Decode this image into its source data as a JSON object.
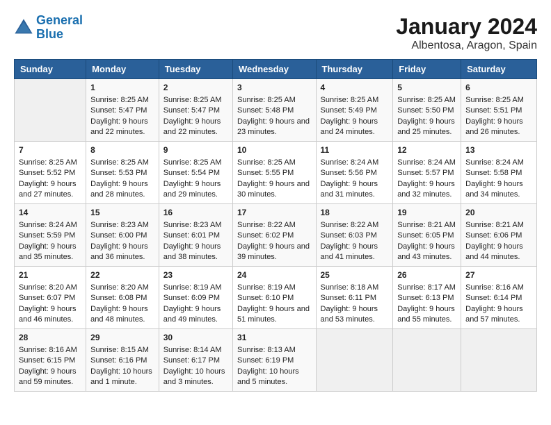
{
  "header": {
    "logo_line1": "General",
    "logo_line2": "Blue",
    "month": "January 2024",
    "location": "Albentosa, Aragon, Spain"
  },
  "days_of_week": [
    "Sunday",
    "Monday",
    "Tuesday",
    "Wednesday",
    "Thursday",
    "Friday",
    "Saturday"
  ],
  "weeks": [
    [
      {
        "day": "",
        "sunrise": "",
        "sunset": "",
        "daylight": ""
      },
      {
        "day": "1",
        "sunrise": "Sunrise: 8:25 AM",
        "sunset": "Sunset: 5:47 PM",
        "daylight": "Daylight: 9 hours and 22 minutes."
      },
      {
        "day": "2",
        "sunrise": "Sunrise: 8:25 AM",
        "sunset": "Sunset: 5:47 PM",
        "daylight": "Daylight: 9 hours and 22 minutes."
      },
      {
        "day": "3",
        "sunrise": "Sunrise: 8:25 AM",
        "sunset": "Sunset: 5:48 PM",
        "daylight": "Daylight: 9 hours and 23 minutes."
      },
      {
        "day": "4",
        "sunrise": "Sunrise: 8:25 AM",
        "sunset": "Sunset: 5:49 PM",
        "daylight": "Daylight: 9 hours and 24 minutes."
      },
      {
        "day": "5",
        "sunrise": "Sunrise: 8:25 AM",
        "sunset": "Sunset: 5:50 PM",
        "daylight": "Daylight: 9 hours and 25 minutes."
      },
      {
        "day": "6",
        "sunrise": "Sunrise: 8:25 AM",
        "sunset": "Sunset: 5:51 PM",
        "daylight": "Daylight: 9 hours and 26 minutes."
      }
    ],
    [
      {
        "day": "7",
        "sunrise": "Sunrise: 8:25 AM",
        "sunset": "Sunset: 5:52 PM",
        "daylight": "Daylight: 9 hours and 27 minutes."
      },
      {
        "day": "8",
        "sunrise": "Sunrise: 8:25 AM",
        "sunset": "Sunset: 5:53 PM",
        "daylight": "Daylight: 9 hours and 28 minutes."
      },
      {
        "day": "9",
        "sunrise": "Sunrise: 8:25 AM",
        "sunset": "Sunset: 5:54 PM",
        "daylight": "Daylight: 9 hours and 29 minutes."
      },
      {
        "day": "10",
        "sunrise": "Sunrise: 8:25 AM",
        "sunset": "Sunset: 5:55 PM",
        "daylight": "Daylight: 9 hours and 30 minutes."
      },
      {
        "day": "11",
        "sunrise": "Sunrise: 8:24 AM",
        "sunset": "Sunset: 5:56 PM",
        "daylight": "Daylight: 9 hours and 31 minutes."
      },
      {
        "day": "12",
        "sunrise": "Sunrise: 8:24 AM",
        "sunset": "Sunset: 5:57 PM",
        "daylight": "Daylight: 9 hours and 32 minutes."
      },
      {
        "day": "13",
        "sunrise": "Sunrise: 8:24 AM",
        "sunset": "Sunset: 5:58 PM",
        "daylight": "Daylight: 9 hours and 34 minutes."
      }
    ],
    [
      {
        "day": "14",
        "sunrise": "Sunrise: 8:24 AM",
        "sunset": "Sunset: 5:59 PM",
        "daylight": "Daylight: 9 hours and 35 minutes."
      },
      {
        "day": "15",
        "sunrise": "Sunrise: 8:23 AM",
        "sunset": "Sunset: 6:00 PM",
        "daylight": "Daylight: 9 hours and 36 minutes."
      },
      {
        "day": "16",
        "sunrise": "Sunrise: 8:23 AM",
        "sunset": "Sunset: 6:01 PM",
        "daylight": "Daylight: 9 hours and 38 minutes."
      },
      {
        "day": "17",
        "sunrise": "Sunrise: 8:22 AM",
        "sunset": "Sunset: 6:02 PM",
        "daylight": "Daylight: 9 hours and 39 minutes."
      },
      {
        "day": "18",
        "sunrise": "Sunrise: 8:22 AM",
        "sunset": "Sunset: 6:03 PM",
        "daylight": "Daylight: 9 hours and 41 minutes."
      },
      {
        "day": "19",
        "sunrise": "Sunrise: 8:21 AM",
        "sunset": "Sunset: 6:05 PM",
        "daylight": "Daylight: 9 hours and 43 minutes."
      },
      {
        "day": "20",
        "sunrise": "Sunrise: 8:21 AM",
        "sunset": "Sunset: 6:06 PM",
        "daylight": "Daylight: 9 hours and 44 minutes."
      }
    ],
    [
      {
        "day": "21",
        "sunrise": "Sunrise: 8:20 AM",
        "sunset": "Sunset: 6:07 PM",
        "daylight": "Daylight: 9 hours and 46 minutes."
      },
      {
        "day": "22",
        "sunrise": "Sunrise: 8:20 AM",
        "sunset": "Sunset: 6:08 PM",
        "daylight": "Daylight: 9 hours and 48 minutes."
      },
      {
        "day": "23",
        "sunrise": "Sunrise: 8:19 AM",
        "sunset": "Sunset: 6:09 PM",
        "daylight": "Daylight: 9 hours and 49 minutes."
      },
      {
        "day": "24",
        "sunrise": "Sunrise: 8:19 AM",
        "sunset": "Sunset: 6:10 PM",
        "daylight": "Daylight: 9 hours and 51 minutes."
      },
      {
        "day": "25",
        "sunrise": "Sunrise: 8:18 AM",
        "sunset": "Sunset: 6:11 PM",
        "daylight": "Daylight: 9 hours and 53 minutes."
      },
      {
        "day": "26",
        "sunrise": "Sunrise: 8:17 AM",
        "sunset": "Sunset: 6:13 PM",
        "daylight": "Daylight: 9 hours and 55 minutes."
      },
      {
        "day": "27",
        "sunrise": "Sunrise: 8:16 AM",
        "sunset": "Sunset: 6:14 PM",
        "daylight": "Daylight: 9 hours and 57 minutes."
      }
    ],
    [
      {
        "day": "28",
        "sunrise": "Sunrise: 8:16 AM",
        "sunset": "Sunset: 6:15 PM",
        "daylight": "Daylight: 9 hours and 59 minutes."
      },
      {
        "day": "29",
        "sunrise": "Sunrise: 8:15 AM",
        "sunset": "Sunset: 6:16 PM",
        "daylight": "Daylight: 10 hours and 1 minute."
      },
      {
        "day": "30",
        "sunrise": "Sunrise: 8:14 AM",
        "sunset": "Sunset: 6:17 PM",
        "daylight": "Daylight: 10 hours and 3 minutes."
      },
      {
        "day": "31",
        "sunrise": "Sunrise: 8:13 AM",
        "sunset": "Sunset: 6:19 PM",
        "daylight": "Daylight: 10 hours and 5 minutes."
      },
      {
        "day": "",
        "sunrise": "",
        "sunset": "",
        "daylight": ""
      },
      {
        "day": "",
        "sunrise": "",
        "sunset": "",
        "daylight": ""
      },
      {
        "day": "",
        "sunrise": "",
        "sunset": "",
        "daylight": ""
      }
    ]
  ]
}
